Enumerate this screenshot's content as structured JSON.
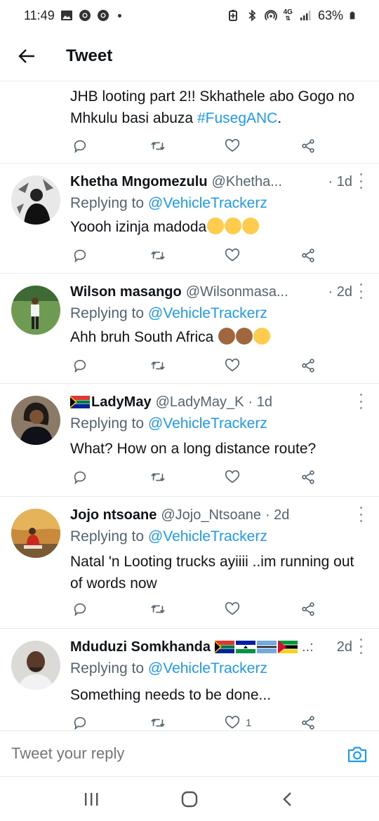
{
  "status_bar": {
    "time": "11:49",
    "network_4g": "4G",
    "battery": "63%",
    "icons": [
      "gallery-icon",
      "chrome-icon",
      "chrome-icon",
      "notification-dot",
      "battery-saver-icon",
      "bluetooth-icon",
      "hotspot-icon",
      "signal-icon",
      "battery-icon"
    ]
  },
  "header": {
    "title": "Tweet",
    "back_icon": "arrow-left-icon"
  },
  "partial_tweet": {
    "text_before": "JHB looting part 2!! Skhathele abo Gogo no Mhkulu basi abuza ",
    "hashtag": "#FusegANC",
    "text_after": "."
  },
  "tweets": [
    {
      "name": "Khetha Mngomezulu",
      "handle": "@Khetha...",
      "time": "· 1d",
      "replying_prefix": "Replying to",
      "replying_to": "@VehicleTrackerz",
      "text": "Yoooh izinja madoda",
      "like_count": ""
    },
    {
      "name": "Wilson masango",
      "handle": "@Wilsonmasa...",
      "time": "· 2d",
      "replying_prefix": "Replying to",
      "replying_to": "@VehicleTrackerz",
      "text": "Ahh bruh South Africa",
      "like_count": ""
    },
    {
      "name": "LadyMay",
      "handle": "@LadyMay_K",
      "time": "· 1d",
      "replying_prefix": "Replying to",
      "replying_to": "@VehicleTrackerz",
      "text": "What? How on a long distance route?",
      "like_count": ""
    },
    {
      "name": "Jojo ntsoane",
      "handle": "@Jojo_Ntsoane",
      "time": "· 2d",
      "replying_prefix": "Replying to",
      "replying_to": "@VehicleTrackerz",
      "text": "Natal 'n Looting trucks ayiiii ..im running out of words now",
      "like_count": ""
    },
    {
      "name": "Mduduzi Somkhanda",
      "handle": "..:",
      "time": "2d",
      "replying_prefix": "Replying to",
      "replying_to": "@VehicleTrackerz",
      "text": "Something needs to be done...",
      "like_count": "1"
    }
  ],
  "reply_bar": {
    "placeholder": "Tweet your reply",
    "camera_icon": "camera-icon"
  },
  "nav_bar": {
    "buttons": [
      "recent-apps-icon",
      "home-icon",
      "back-icon"
    ]
  },
  "colors": {
    "accent": "#1d9bf0",
    "secondary_text": "#536471",
    "divider": "#e6ecf0"
  }
}
